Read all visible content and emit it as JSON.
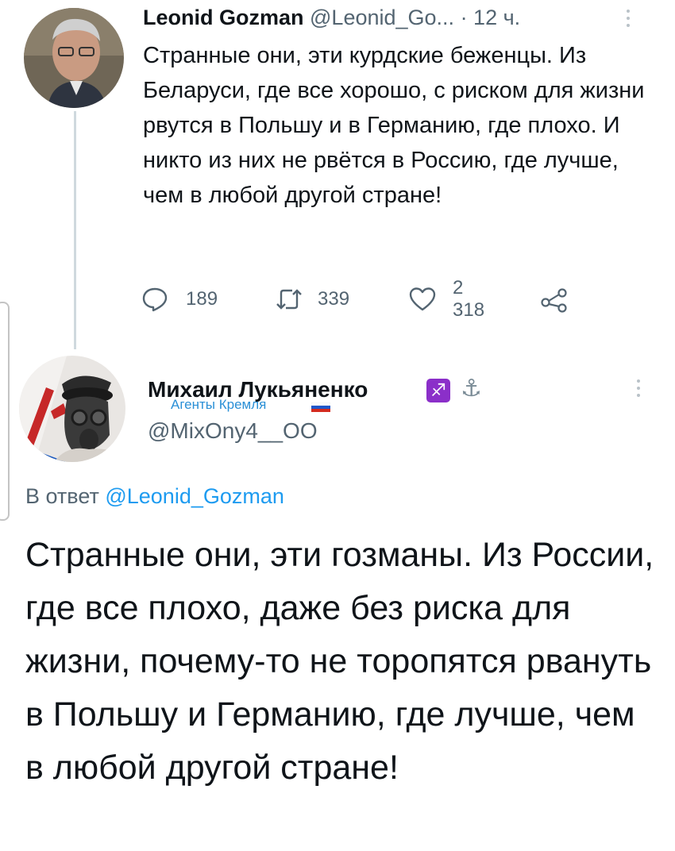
{
  "tweet1": {
    "name": "Leonid Gozman",
    "handle": "@Leonid_Go...",
    "time": "· 12 ч.",
    "text": "Странные они, эти курдские беженцы. Из Беларуси, где все хорошо, с риском для жизни рвутся в Польшу и в Германию, где плохо. И никто из них не рвётся в Россию, где лучше, чем в любой другой стране!",
    "replies": "189",
    "retweets": "339",
    "likes": "2 318",
    "icons": {
      "reply": "speech-bubble-icon",
      "retweet": "retweet-icon",
      "like": "heart-icon",
      "share": "share-icon",
      "more": "more-vertical-icon"
    }
  },
  "tweet2": {
    "name": "Михаил Лукьяненко",
    "label": "Агенты Кремля",
    "handle": "@MixOny4__OO",
    "reply_prefix": "В ответ",
    "reply_mention": "@Leonid_Gozman",
    "text": "Странные они, эти гозманы. Из России, где все плохо, даже без риска для жизни, почему-то не торопятся рвануть в Польшу и Германию, где лучше, чем в любой другой стране!",
    "emoji_badge": "♐",
    "anchor": "⚓"
  },
  "colors": {
    "text": "#0f1419",
    "secondary": "#536471",
    "link": "#1d9bf0",
    "badge": "#2a8fd6"
  }
}
